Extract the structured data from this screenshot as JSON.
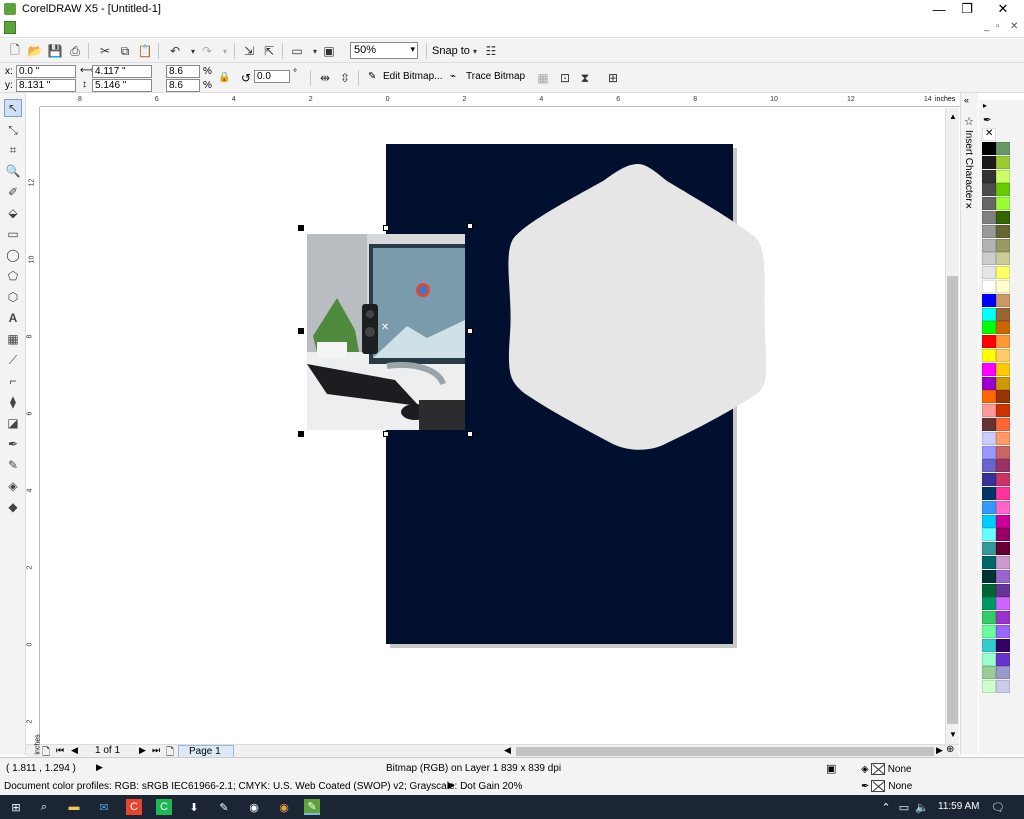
{
  "window": {
    "title": "CorelDRAW X5 - [Untitled-1]",
    "minimize": "—",
    "restore": "❐",
    "close": "✕"
  },
  "mdi": {
    "min": "_",
    "restore": "▫",
    "close": "✕"
  },
  "standard_toolbar": {
    "zoom_level": "50%",
    "snap_to": "Snap to"
  },
  "property_bar": {
    "x_label": "x:",
    "x": "0.0 \"",
    "y_label": "y:",
    "y": "8.131 \"",
    "width": "4.117 \"",
    "height": "5.146 \"",
    "scale_x": "8.6",
    "scale_y": "8.6",
    "percent": "%",
    "rotation": "0.0",
    "degree": "°",
    "edit_bitmap": "Edit Bitmap...",
    "trace_bitmap": "Trace Bitmap"
  },
  "ruler": {
    "units": "inches",
    "h_ticks": [
      "8",
      "6",
      "4",
      "2",
      "0",
      "2",
      "4",
      "6",
      "8",
      "10",
      "12",
      "14"
    ],
    "v_ticks": [
      "12",
      "10",
      "8",
      "6",
      "4",
      "2",
      "0",
      "2"
    ]
  },
  "docker": {
    "title": "Insert Character"
  },
  "page_nav": {
    "count": "1 of 1",
    "tab": "Page 1",
    "units": "inches"
  },
  "status": {
    "coordinates": "( 1.811 , 1.294 )",
    "object_info": "Bitmap (RGB) on Layer 1 839 x 839 dpi",
    "color_profiles": "Document color profiles: RGB: sRGB IEC61966-2.1; CMYK: U.S. Web Coated (SWOP) v2; Grayscale: Dot Gain 20%",
    "fill": "None",
    "outline": "None"
  },
  "taskbar": {
    "time": "11:59 AM"
  },
  "colors": {
    "page": "#021030",
    "hexagon": "#e6e6e6",
    "palette": [
      "#000000",
      "#1a1a1a",
      "#333333",
      "#4d4d4d",
      "#666666",
      "#808080",
      "#999999",
      "#b3b3b3",
      "#cccccc",
      "#e6e6e6",
      "#ffffff",
      "#0000ff",
      "#00ffff",
      "#00ff00",
      "#ff0000",
      "#ffff00",
      "#ff00ff",
      "#9900cc",
      "#ff6600",
      "#ff9999",
      "#663333",
      "#ccccff",
      "#9999ff",
      "#6666cc",
      "#333399",
      "#003366",
      "#3399ff",
      "#00ccff",
      "#66ffff",
      "#339999",
      "#006666",
      "#003333",
      "#006633",
      "#009966",
      "#33cc66",
      "#66ff99",
      "#33cccc",
      "#99ffcc",
      "#99cc99",
      "#ccffcc"
    ],
    "palette2": [
      "#669966",
      "#99cc33",
      "#ccff66",
      "#66cc00",
      "#99ff33",
      "#336600",
      "#666633",
      "#999966",
      "#cccc99",
      "#ffff66",
      "#ffffcc",
      "#cc9966",
      "#996633",
      "#cc6600",
      "#ff9933",
      "#ffcc66",
      "#ffcc00",
      "#cc9900",
      "#993300",
      "#cc3300",
      "#ff6633",
      "#ff9966",
      "#cc6666",
      "#993366",
      "#cc3366",
      "#ff3399",
      "#ff66cc",
      "#cc0099",
      "#990066",
      "#660033",
      "#cc99cc",
      "#9966cc",
      "#663399",
      "#cc66ff",
      "#9933cc",
      "#9966ff",
      "#330066",
      "#6633cc",
      "#9999cc",
      "#ccccee"
    ]
  }
}
